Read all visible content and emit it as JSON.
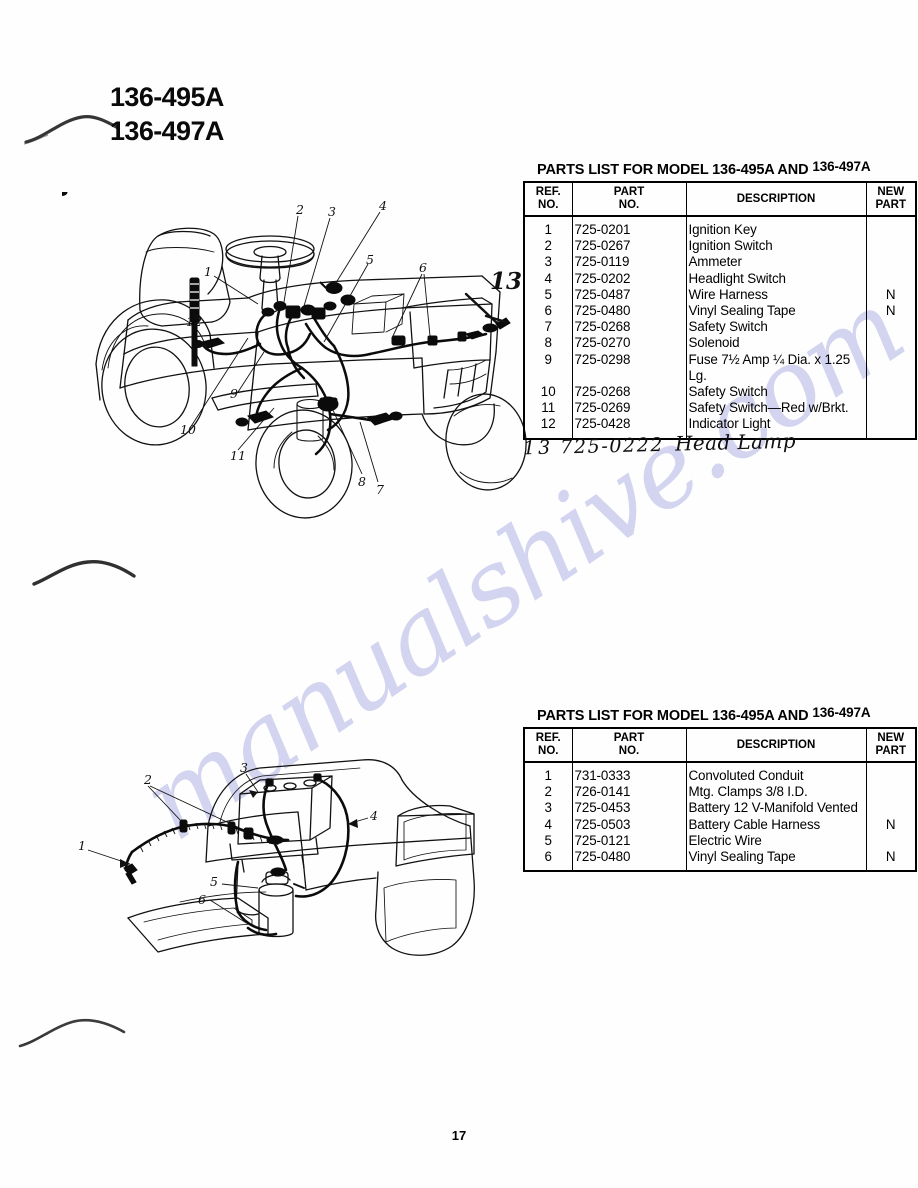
{
  "document": {
    "page_number": "17",
    "watermark": "manualshive.com"
  },
  "model_heading": {
    "line1": "136-495A",
    "line2": "136-497A"
  },
  "table_one": {
    "title_main": "PARTS LIST FOR MODEL 136-495A AND",
    "title_alt": "136-497A",
    "headers": {
      "ref": "REF.\nNO.",
      "ref_l1": "REF.",
      "ref_l2": "NO.",
      "part_l1": "PART",
      "part_l2": "NO.",
      "description": "DESCRIPTION",
      "new_l1": "NEW",
      "new_l2": "PART"
    },
    "rows": [
      {
        "ref": "1",
        "part": "725-0201",
        "desc": "Ignition Key",
        "new": ""
      },
      {
        "ref": "2",
        "part": "725-0267",
        "desc": "Ignition Switch",
        "new": ""
      },
      {
        "ref": "3",
        "part": "725-0119",
        "desc": "Ammeter",
        "new": ""
      },
      {
        "ref": "4",
        "part": "725-0202",
        "desc": "Headlight Switch",
        "new": ""
      },
      {
        "ref": "5",
        "part": "725-0487",
        "desc": "Wire Harness",
        "new": "N"
      },
      {
        "ref": "6",
        "part": "725-0480",
        "desc": "Vinyl Sealing Tape",
        "new": "N"
      },
      {
        "ref": "7",
        "part": "725-0268",
        "desc": "Safety Switch",
        "new": ""
      },
      {
        "ref": "8",
        "part": "725-0270",
        "desc": "Solenoid",
        "new": ""
      },
      {
        "ref": "9",
        "part": "725-0298",
        "desc": "Fuse 7½ Amp ¼ Dia. x 1.25\n     Lg.",
        "new": ""
      },
      {
        "ref": "10",
        "part": "725-0268",
        "desc": "Safety Switch",
        "new": ""
      },
      {
        "ref": "11",
        "part": "725-0269",
        "desc": "Safety Switch—Red w/Brkt.",
        "new": ""
      },
      {
        "ref": "12",
        "part": "725-0428",
        "desc": "Indicator Light",
        "new": ""
      }
    ]
  },
  "handwritten_note": {
    "ref": "13",
    "part": "725-0222",
    "desc": "Head Lamp"
  },
  "table_two": {
    "title_main": "PARTS LIST FOR MODEL 136-495A AND",
    "title_alt": "136-497A",
    "headers": {
      "ref_l1": "REF.",
      "ref_l2": "NO.",
      "part_l1": "PART",
      "part_l2": "NO.",
      "description": "DESCRIPTION",
      "new_l1": "NEW",
      "new_l2": "PART"
    },
    "rows": [
      {
        "ref": "1",
        "part": "731-0333",
        "desc": "Convoluted Conduit",
        "new": ""
      },
      {
        "ref": "2",
        "part": "726-0141",
        "desc": "Mtg. Clamps 3/8 I.D.",
        "new": ""
      },
      {
        "ref": "3",
        "part": "725-0453",
        "desc": "Battery 12 V-Manifold Vented",
        "new": ""
      },
      {
        "ref": "4",
        "part": "725-0503",
        "desc": "Battery Cable Harness",
        "new": "N"
      },
      {
        "ref": "5",
        "part": "725-0121",
        "desc": "Electric Wire",
        "new": ""
      },
      {
        "ref": "6",
        "part": "725-0480",
        "desc": "Vinyl Sealing Tape",
        "new": "N"
      }
    ]
  },
  "illustration_one": {
    "name": "tractor-wiring-assembly-diagram",
    "callouts": [
      "1",
      "2",
      "3",
      "4",
      "5",
      "6",
      "7",
      "8",
      "9",
      "10",
      "11",
      "12"
    ],
    "handwritten_callout": "13"
  },
  "illustration_two": {
    "name": "battery-cable-assembly-diagram",
    "callouts": [
      "1",
      "2",
      "3",
      "4",
      "5",
      "6"
    ]
  },
  "colors": {
    "ink": "#000000",
    "watermark": "#b9bbe6",
    "paper": "#fefefe"
  }
}
